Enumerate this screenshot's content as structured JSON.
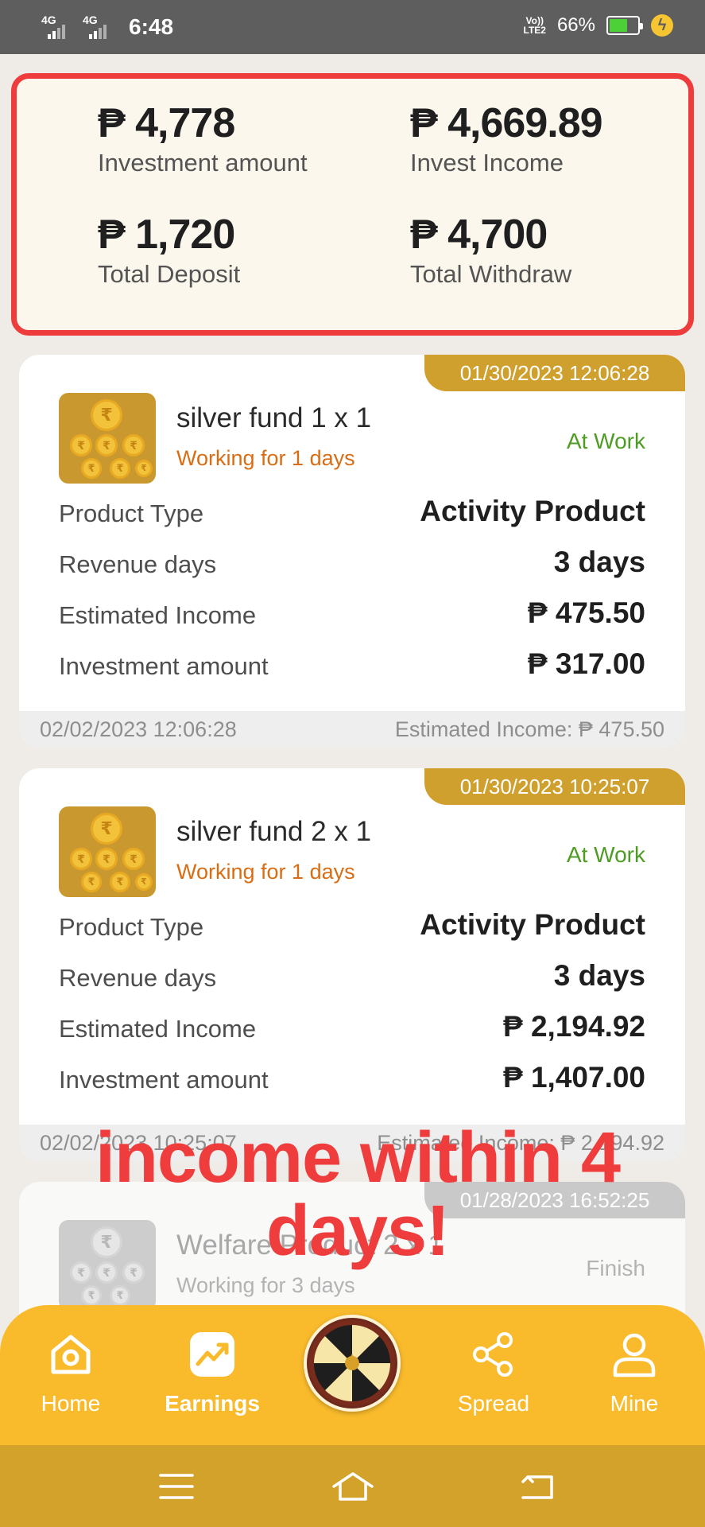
{
  "status_bar": {
    "signal_1": "4G",
    "signal_2": "4G",
    "time": "6:48",
    "volte_line1": "Vo))",
    "volte_line2": "LTE2",
    "battery_percent": "66%",
    "battery_level": 0.66
  },
  "summary": {
    "investment_amount": {
      "value": "₱ 4,778",
      "label": "Investment amount"
    },
    "invest_income": {
      "value": "₱ 4,669.89",
      "label": "Invest Income"
    },
    "total_deposit": {
      "value": "₱ 1,720",
      "label": "Total Deposit"
    },
    "total_withdraw": {
      "value": "₱ 4,700",
      "label": "Total Withdraw"
    }
  },
  "products": [
    {
      "timestamp": "01/30/2023 12:06:28",
      "name": "silver fund 1 x 1",
      "working": "Working for 1 days",
      "status": "At Work",
      "rows": [
        {
          "label": "Product Type",
          "value": "Activity Product"
        },
        {
          "label": "Revenue days",
          "value": "3 days"
        },
        {
          "label": "Estimated Income",
          "value": "₱ 475.50"
        },
        {
          "label": "Investment amount",
          "value": "₱ 317.00"
        }
      ],
      "footer_date": "02/02/2023 12:06:28",
      "footer_income": "Estimated Income: ₱ 475.50"
    },
    {
      "timestamp": "01/30/2023 10:25:07",
      "name": "silver fund 2 x 1",
      "working": "Working for 1 days",
      "status": "At Work",
      "rows": [
        {
          "label": "Product Type",
          "value": "Activity Product"
        },
        {
          "label": "Revenue days",
          "value": "3 days"
        },
        {
          "label": "Estimated Income",
          "value": "₱ 2,194.92"
        },
        {
          "label": "Investment amount",
          "value": "₱ 1,407.00"
        }
      ],
      "footer_date": "02/02/2023 10:25:07",
      "footer_income": "Estimated Income: ₱ 2,194.92"
    },
    {
      "timestamp": "01/28/2023 16:52:25",
      "name": "Welfare Product 2 x 1",
      "working": "Working for 3 days",
      "status": "Finish"
    }
  ],
  "overlay_text": "income within 4 days!",
  "bottom_nav": {
    "items": [
      {
        "label": "Home",
        "icon": "home-icon"
      },
      {
        "label": "Earnings",
        "icon": "trending-up-icon",
        "active": true
      },
      {
        "label": "",
        "icon": "prize-wheel-icon"
      },
      {
        "label": "Spread",
        "icon": "share-icon"
      },
      {
        "label": "Mine",
        "icon": "person-icon"
      }
    ]
  },
  "colors": {
    "accent": "#f9bb2c",
    "tag": "#cfa02d",
    "highlight_border": "#ee3b3b",
    "status_at_work": "#4e9c23",
    "working_text": "#d96d14",
    "overlay": "#ef3d3d"
  }
}
